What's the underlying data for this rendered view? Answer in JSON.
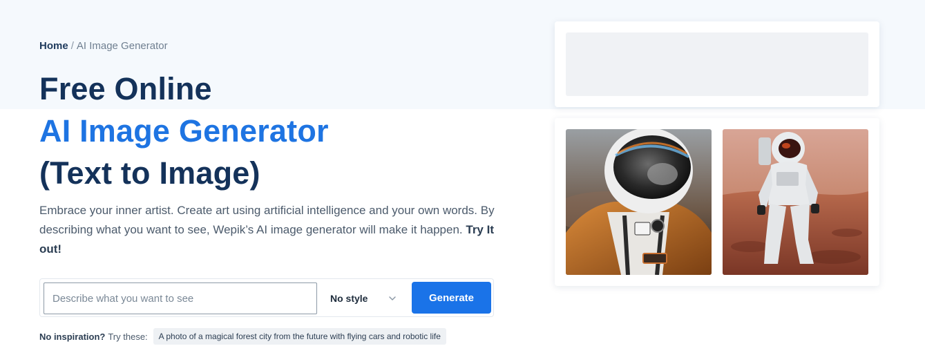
{
  "breadcrumb": {
    "home": "Home",
    "separator": "/",
    "current": "AI Image Generator"
  },
  "hero": {
    "title_line1": "Free Online",
    "title_line2": "AI Image Generator",
    "title_line3": "(Text to Image)",
    "description": "Embrace your inner artist. Create art using artificial intelligence and your own words. By describing what you want to see, Wepik’s AI image generator will make it happen. ",
    "cta": "Try It out!"
  },
  "generator": {
    "input_value": "",
    "input_placeholder": "Describe what you want to see",
    "style_selected": "No style",
    "generate_label": "Generate"
  },
  "inspiration": {
    "lead": "No inspiration?",
    "try_text": "Try these:",
    "suggestion": "A photo of a magical forest city from the future with flying cars and robotic life"
  },
  "colors": {
    "accent": "#1e74e2",
    "title": "#14325a",
    "button": "#1a73e8"
  },
  "icons": {
    "style_dropdown": "chevron-down-icon"
  },
  "gallery": {
    "images": [
      "astronaut-closeup-image",
      "astronaut-on-mars-image"
    ]
  }
}
